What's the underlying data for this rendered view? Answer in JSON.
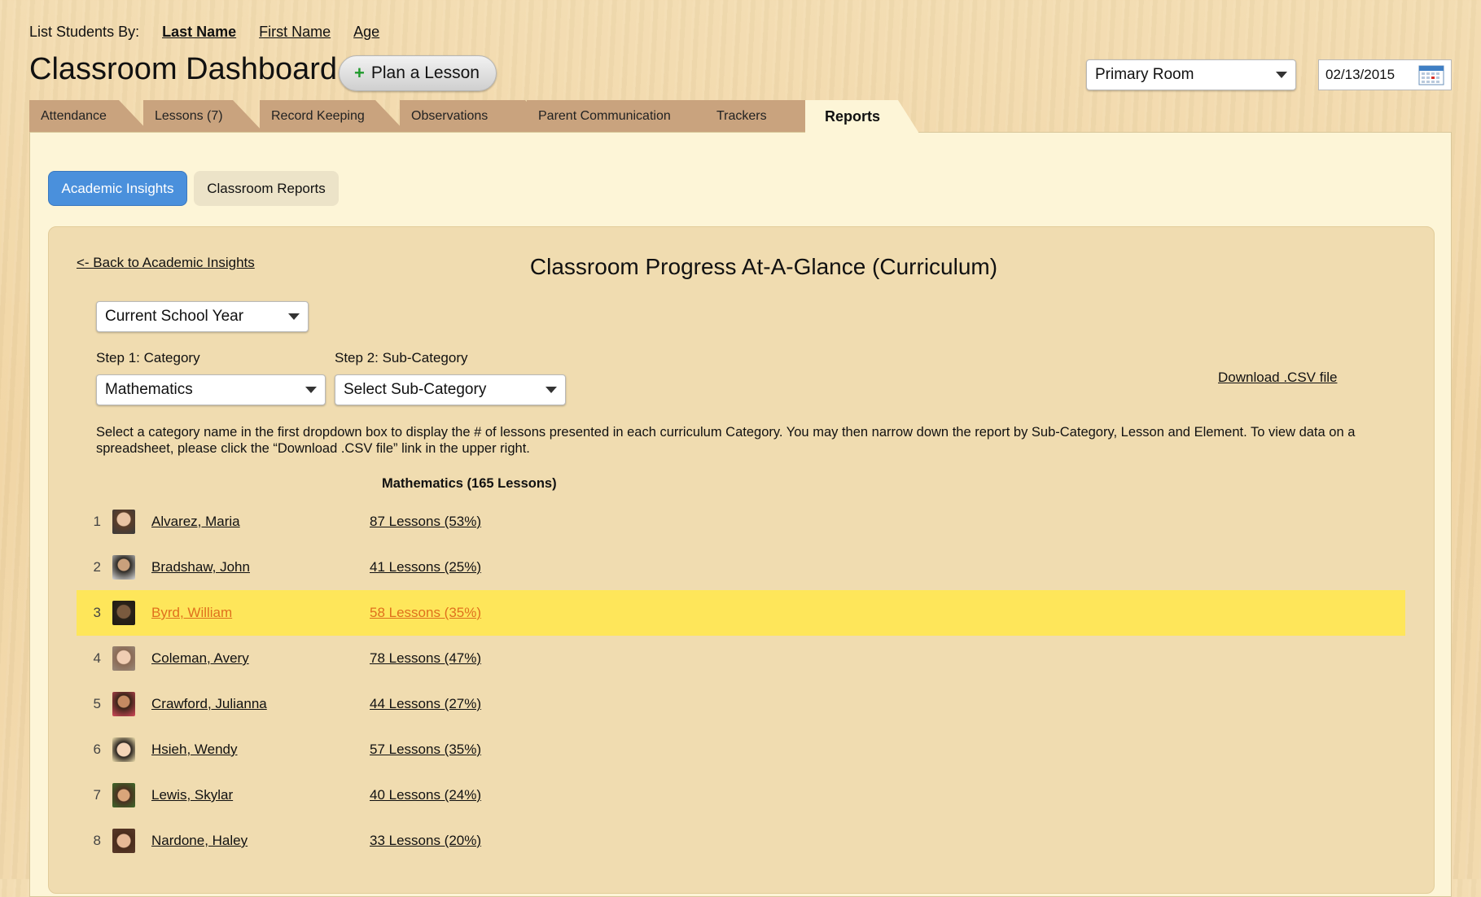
{
  "sort": {
    "label": "List Students By:",
    "options": [
      "Last Name",
      "First Name",
      "Age"
    ],
    "active": "Last Name"
  },
  "header": {
    "title": "Classroom Dashboard",
    "plan_button": "Plan a Lesson",
    "plan_icon": "+",
    "room": "Primary Room",
    "date": "02/13/2015"
  },
  "tabs": [
    {
      "label": "Attendance"
    },
    {
      "label": "Lessons (7)"
    },
    {
      "label": "Record Keeping"
    },
    {
      "label": "Observations"
    },
    {
      "label": "Parent Communication"
    },
    {
      "label": "Trackers"
    },
    {
      "label": "Reports"
    }
  ],
  "active_tab": "Reports",
  "subtabs": {
    "academic": "Academic Insights",
    "classroom": "Classroom Reports"
  },
  "report": {
    "back_link": "<- Back to Academic Insights",
    "title": "Classroom Progress At-A-Glance (Curriculum)",
    "year_select": "Current School Year",
    "step1_label": "Step 1: Category",
    "step2_label": "Step 2: Sub-Category",
    "category": "Mathematics",
    "subcategory": "Select Sub-Category",
    "csv_link": "Download .CSV file",
    "help_text": "Select a category name in the first dropdown box to display the # of lessons presented in each curriculum Category. You may then narrow down the report by Sub-Category, Lesson and Element. To view data on a spreadsheet, please click the “Download .CSV file” link in the upper right.",
    "column_header": "Mathematics (165 Lessons)"
  },
  "students": [
    {
      "num": "1",
      "name": "Alvarez, Maria",
      "lessons": "87 Lessons (53%)",
      "highlight": false
    },
    {
      "num": "2",
      "name": "Bradshaw, John",
      "lessons": "41 Lessons (25%)",
      "highlight": false
    },
    {
      "num": "3",
      "name": "Byrd, William",
      "lessons": "58 Lessons (35%)",
      "highlight": true
    },
    {
      "num": "4",
      "name": "Coleman, Avery",
      "lessons": "78 Lessons (47%)",
      "highlight": false
    },
    {
      "num": "5",
      "name": "Crawford, Julianna",
      "lessons": "44 Lessons (27%)",
      "highlight": false
    },
    {
      "num": "6",
      "name": "Hsieh, Wendy",
      "lessons": "57 Lessons (35%)",
      "highlight": false
    },
    {
      "num": "7",
      "name": "Lewis, Skylar",
      "lessons": "40 Lessons (24%)",
      "highlight": false
    },
    {
      "num": "8",
      "name": "Nardone, Haley",
      "lessons": "33 Lessons (20%)",
      "highlight": false
    }
  ],
  "colors": {
    "accent_blue": "#4a90dc",
    "highlight_row": "#fee65a",
    "highlight_text": "#e0701d",
    "tab_inactive": "#c9a37e",
    "panel_bg": "#fdf5d7"
  }
}
